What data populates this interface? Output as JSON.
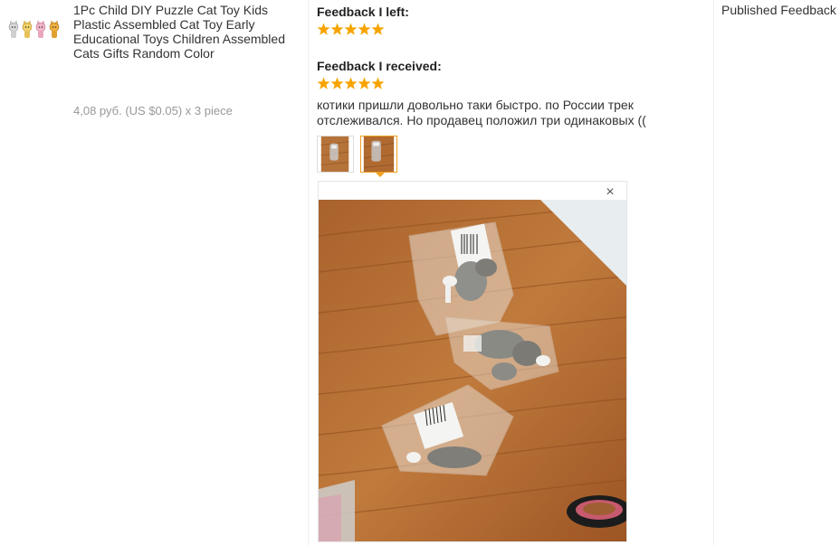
{
  "product": {
    "image_icon": "cat-toys-thumbnail",
    "title": "1Pc Child DIY Puzzle Cat Toy Kids Plastic Assembled Cat Toy Early Educational Toys Children Assembled Cats Gifts Random Color",
    "price": "4,08 руб. (US $0.05) x 3 piece"
  },
  "feedback": {
    "left_label": "Feedback I left:",
    "left_rating": 5,
    "received_label": "Feedback I received:",
    "received_rating": 5,
    "review_text": "котики пришли довольно таки быстро. по России трек отслеживался. Но продавец положил три одинаковых ((",
    "photos": [
      {
        "icon": "review-photo-1",
        "active": false
      },
      {
        "icon": "review-photo-2",
        "active": true
      }
    ],
    "close_glyph": "×",
    "star_color": "#f7a400"
  },
  "status": {
    "text": "Published Feedback"
  }
}
